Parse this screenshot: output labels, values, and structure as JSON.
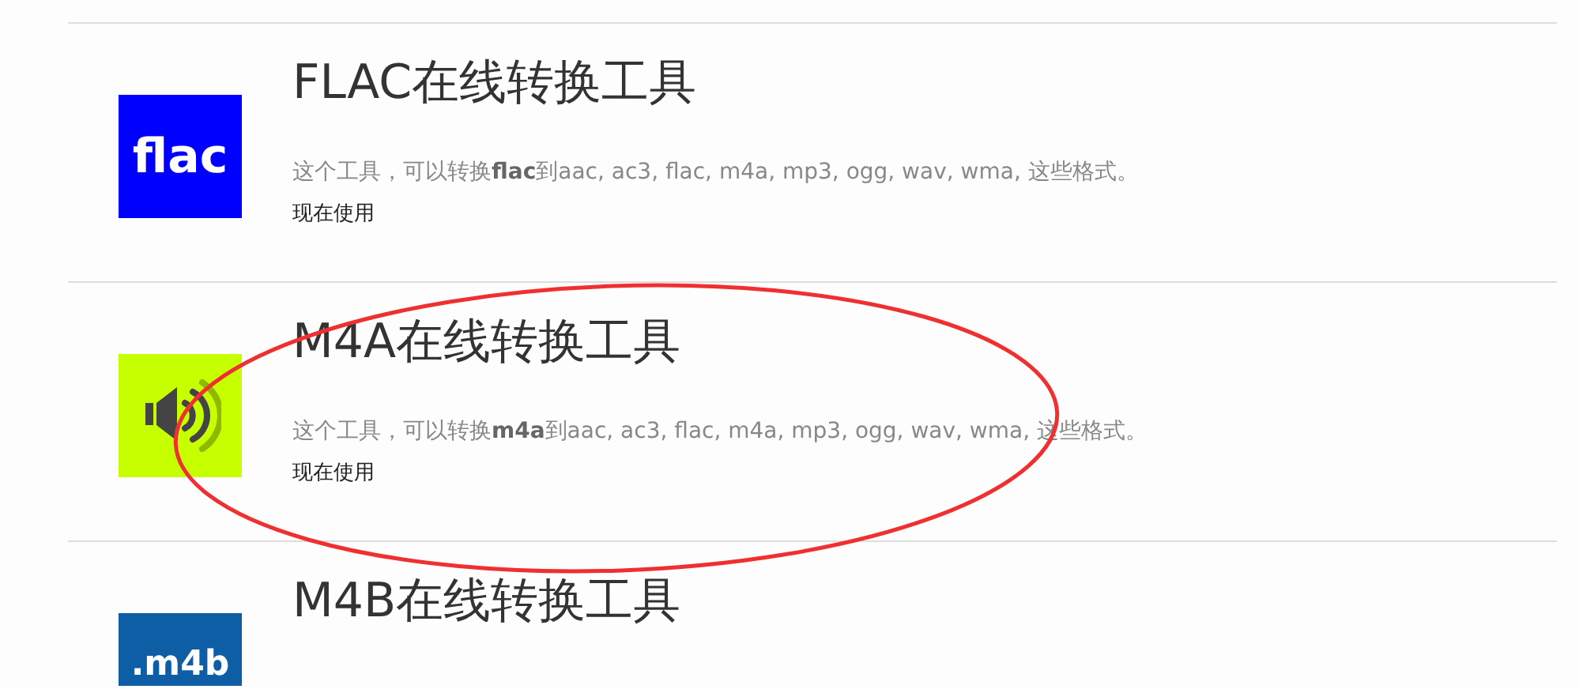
{
  "tools": [
    {
      "title": "FLAC在线转换工具",
      "logo": {
        "kind": "text",
        "text": "flac",
        "color": "#0000ff"
      },
      "description": "这个工具，可以转换**flac**到aac, ac3, flac, m4a, mp3, ogg, wav, wma, 这些格式。",
      "link": "现在使用"
    },
    {
      "title": "M4A在线转换工具",
      "logo": {
        "kind": "speaker",
        "color": "#c6ff00"
      },
      "description": "这个工具，可以转换**m4a**到aac, ac3, flac, m4a, mp3, ogg, wav, wma, 这些格式。",
      "link": "现在使用"
    },
    {
      "title": "M4B在线转换工具",
      "logo": {
        "kind": "text",
        "text": ".m4b",
        "color": "#0e5ea6"
      }
    }
  ],
  "highlight": {
    "kind": "ellipse",
    "color": "#f03030"
  }
}
